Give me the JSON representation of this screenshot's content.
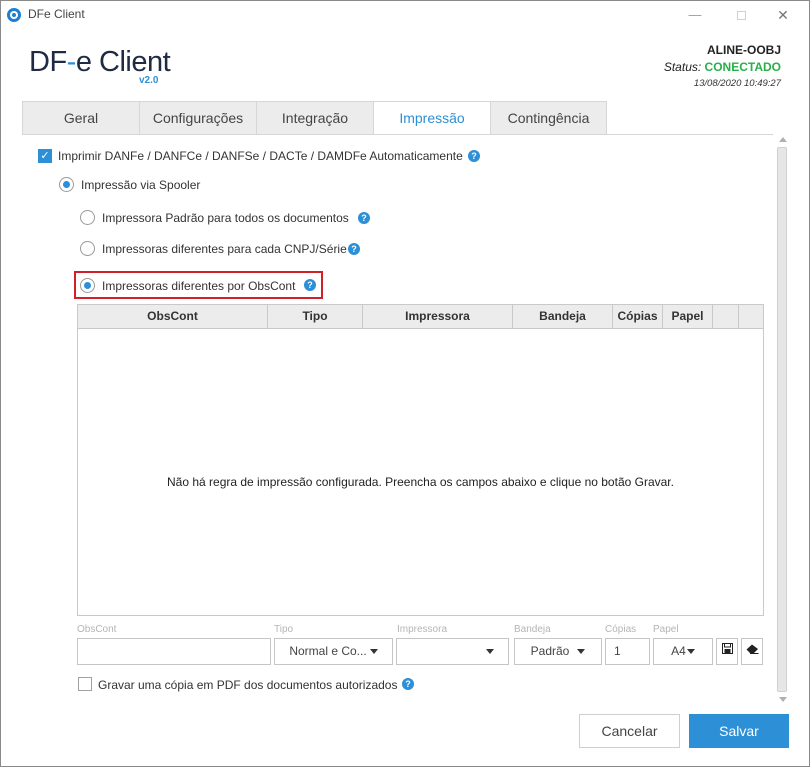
{
  "window": {
    "title": "DFe Client"
  },
  "logo": {
    "part1": "DF",
    "part2": "-",
    "part3": "e Client",
    "version": "v2.0"
  },
  "status": {
    "user": "ALINE-OOBJ",
    "label": "Status:",
    "value": "CONECTADO",
    "timestamp": "13/08/2020 10:49:27"
  },
  "tabs": [
    {
      "label": "Geral",
      "active": false
    },
    {
      "label": "Configurações",
      "active": false
    },
    {
      "label": "Integração",
      "active": false
    },
    {
      "label": "Impressão",
      "active": true
    },
    {
      "label": "Contingência",
      "active": false
    }
  ],
  "options": {
    "auto_print_label": "Imprimir DANFe / DANFCe / DANFSe / DACTe / DAMDFe Automaticamente",
    "auto_print_checked": true,
    "spooler_label": "Impressão via Spooler",
    "spooler_checked": true,
    "radio_default": "Impressora Padrão para todos os documentos",
    "radio_cnpj": "Impressoras diferentes para cada CNPJ/Série",
    "radio_obscont": "Impressoras diferentes por ObsCont",
    "selected_radio": "radio_obscont"
  },
  "grid": {
    "columns": [
      "ObsCont",
      "Tipo",
      "Impressora",
      "Bandeja",
      "Cópias",
      "Papel",
      ""
    ],
    "empty_message": "Não há regra de impressão configurada. Preencha os campos abaixo e clique no botão Gravar."
  },
  "form": {
    "obscont_label": "ObsCont",
    "obscont_value": "",
    "tipo_label": "Tipo",
    "tipo_value": "Normal e Co...",
    "impressora_label": "Impressora",
    "impressora_value": "",
    "bandeja_label": "Bandeja",
    "bandeja_value": "Padrão",
    "copias_label": "Cópias",
    "copias_value": "1",
    "papel_label": "Papel",
    "papel_value": "A4"
  },
  "pdf_copy": {
    "label": "Gravar uma cópia em PDF dos documentos autorizados",
    "checked": false
  },
  "buttons": {
    "cancel": "Cancelar",
    "save": "Salvar"
  },
  "colors": {
    "accent": "#2d8fd6",
    "status_connected": "#27b04a",
    "highlight_border": "#d0202a"
  }
}
